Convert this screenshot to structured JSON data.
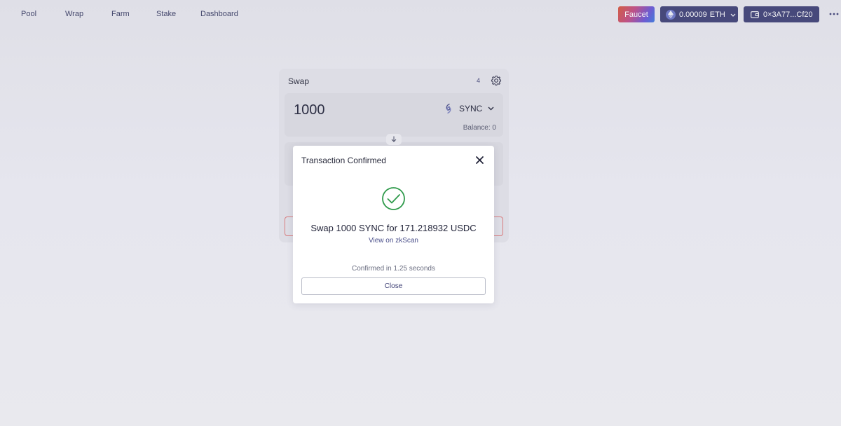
{
  "nav": {
    "items": [
      {
        "label": "Pool"
      },
      {
        "label": "Wrap"
      },
      {
        "label": "Farm"
      },
      {
        "label": "Stake"
      },
      {
        "label": "Dashboard"
      }
    ],
    "faucet_label": "Faucet",
    "eth_balance": "0.00009",
    "eth_symbol": "ETH",
    "account_label": "0×3A77...Cf20"
  },
  "swap": {
    "title": "Swap",
    "slippage_badge": "4",
    "from": {
      "amount": "1000",
      "token": "SYNC",
      "balance_label": "Balance: 0"
    }
  },
  "modal": {
    "title": "Transaction Confirmed",
    "summary": "Swap 1000 SYNC for 171.218932 USDC",
    "link_label": "View on zkScan",
    "confirmed_text": "Confirmed in 1.25 seconds",
    "close_label": "Close"
  },
  "colors": {
    "accent": "#3f4176",
    "success": "#2e9a4a",
    "error_border": "#e07a7a"
  }
}
